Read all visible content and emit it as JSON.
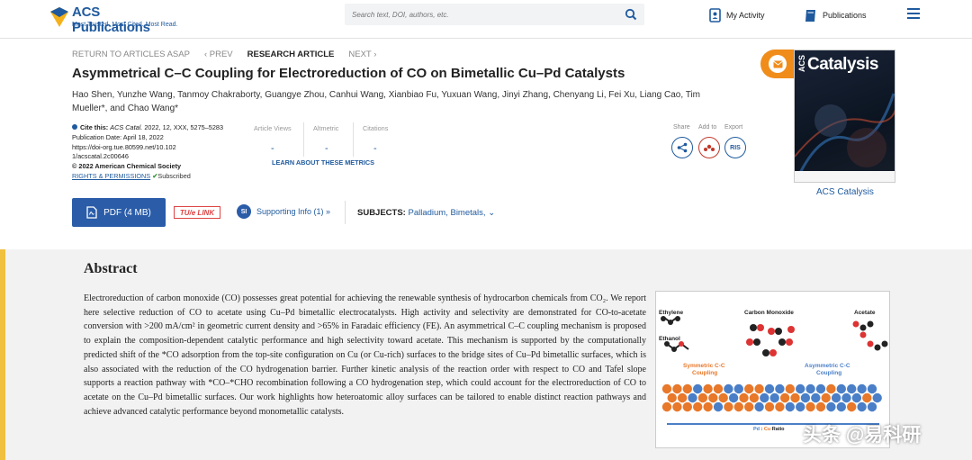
{
  "header": {
    "logo_name": "ACS Publications",
    "logo_tagline": "Most Trusted. Most Cited. Most Read.",
    "search_placeholder": "Search text, DOI, authors, etc.",
    "my_activity": "My Activity",
    "publications": "Publications"
  },
  "nav": {
    "return": "RETURN TO ARTICLES ASAP",
    "prev": "‹ PREV",
    "type": "RESEARCH ARTICLE",
    "next": "NEXT ›"
  },
  "article": {
    "title": "Asymmetrical C–C Coupling for Electroreduction of CO on Bimetallic Cu–Pd Catalysts",
    "authors": "Hao Shen, Yunzhe Wang, Tanmoy Chakraborty, Guangye Zhou, Canhui Wang, Xianbiao Fu, Yuxuan Wang, Jinyi Zhang, Chenyang Li, Fei Xu, Liang Cao, Tim Mueller*, and Chao Wang*",
    "cite_label": "Cite this:",
    "cite_journal": "ACS Catal.",
    "cite_rest": "2022, 12, XXX, 5275–5283",
    "pub_date": "Publication Date: April 18, 2022",
    "doi": "https://doi-org.tue.80599.net/10.1021/acscatal.2c00646",
    "copyright": "© 2022 American Chemical Society",
    "rights": "RIGHTS & PERMISSIONS",
    "subscribed": "Subscribed"
  },
  "metrics": {
    "views_label": "Article Views",
    "views_value": "-",
    "altmetric_label": "Altmetric",
    "altmetric_value": "-",
    "citations_label": "Citations",
    "citations_value": "-",
    "learn": "LEARN ABOUT THESE METRICS"
  },
  "share": {
    "share": "Share",
    "add_to": "Add to",
    "export": "Export",
    "ris": "RIS"
  },
  "actions": {
    "pdf": "PDF (4 MB)",
    "tue": "TU/e LINK",
    "si_badge": "SI",
    "supporting": "Supporting Info (1) »",
    "subjects_label": "SUBJECTS:",
    "subjects": "Palladium, Bimetals,"
  },
  "cover": {
    "acs": "ACS",
    "journal": "Catalysis",
    "link": "ACS Catalysis"
  },
  "abstract": {
    "heading": "Abstract",
    "text": "Electroreduction of carbon monoxide (CO) possesses great potential for achieving the renewable synthesis of hydrocarbon chemicals from CO₂. We report here selective reduction of CO to acetate using Cu–Pd bimetallic electrocatalysts. High activity and selectivity are demonstrated for CO-to-acetate conversion with >200 mA/cm² in geometric current density and >65% in Faradaic efficiency (FE). An asymmetrical C–C coupling mechanism is proposed to explain the composition-dependent catalytic performance and high selectivity toward acetate. This mechanism is supported by the computationally predicted shift of the *CO adsorption from the top-site configuration on Cu (or Cu-rich) surfaces to the bridge sites of Cu–Pd bimetallic surfaces, which is also associated with the reduction of the CO hydrogenation barrier. Further kinetic analysis of the reaction order with respect to CO and Tafel slope supports a reaction pathway with *CO–*CHO recombination following a CO hydrogenation step, which could account for the electroreduction of CO to acetate on the Cu–Pd bimetallic surfaces. Our work highlights how heteroatomic alloy surfaces can be tailored to enable distinct reaction pathways and achieve advanced catalytic performance beyond monometallic catalysts."
  },
  "toc": {
    "ethylene": "Ethylene",
    "ethanol": "Ethanol",
    "co": "Carbon Monoxide",
    "acetate": "Acetate",
    "sym": "Symmetric C-C Coupling",
    "asym": "Asymmetric C-C Coupling",
    "ratio_pd": "Pd",
    "ratio_sep": " : ",
    "ratio_cu": "Cu",
    "ratio_word": " Ratio"
  },
  "watermark": "头条 @易科研",
  "colors": {
    "brand_blue": "#1f5a9e",
    "pdf_blue": "#2a5ca8",
    "orange": "#f08c1a",
    "cu_orange": "#e8782a",
    "pd_blue": "#4a7fc8"
  }
}
